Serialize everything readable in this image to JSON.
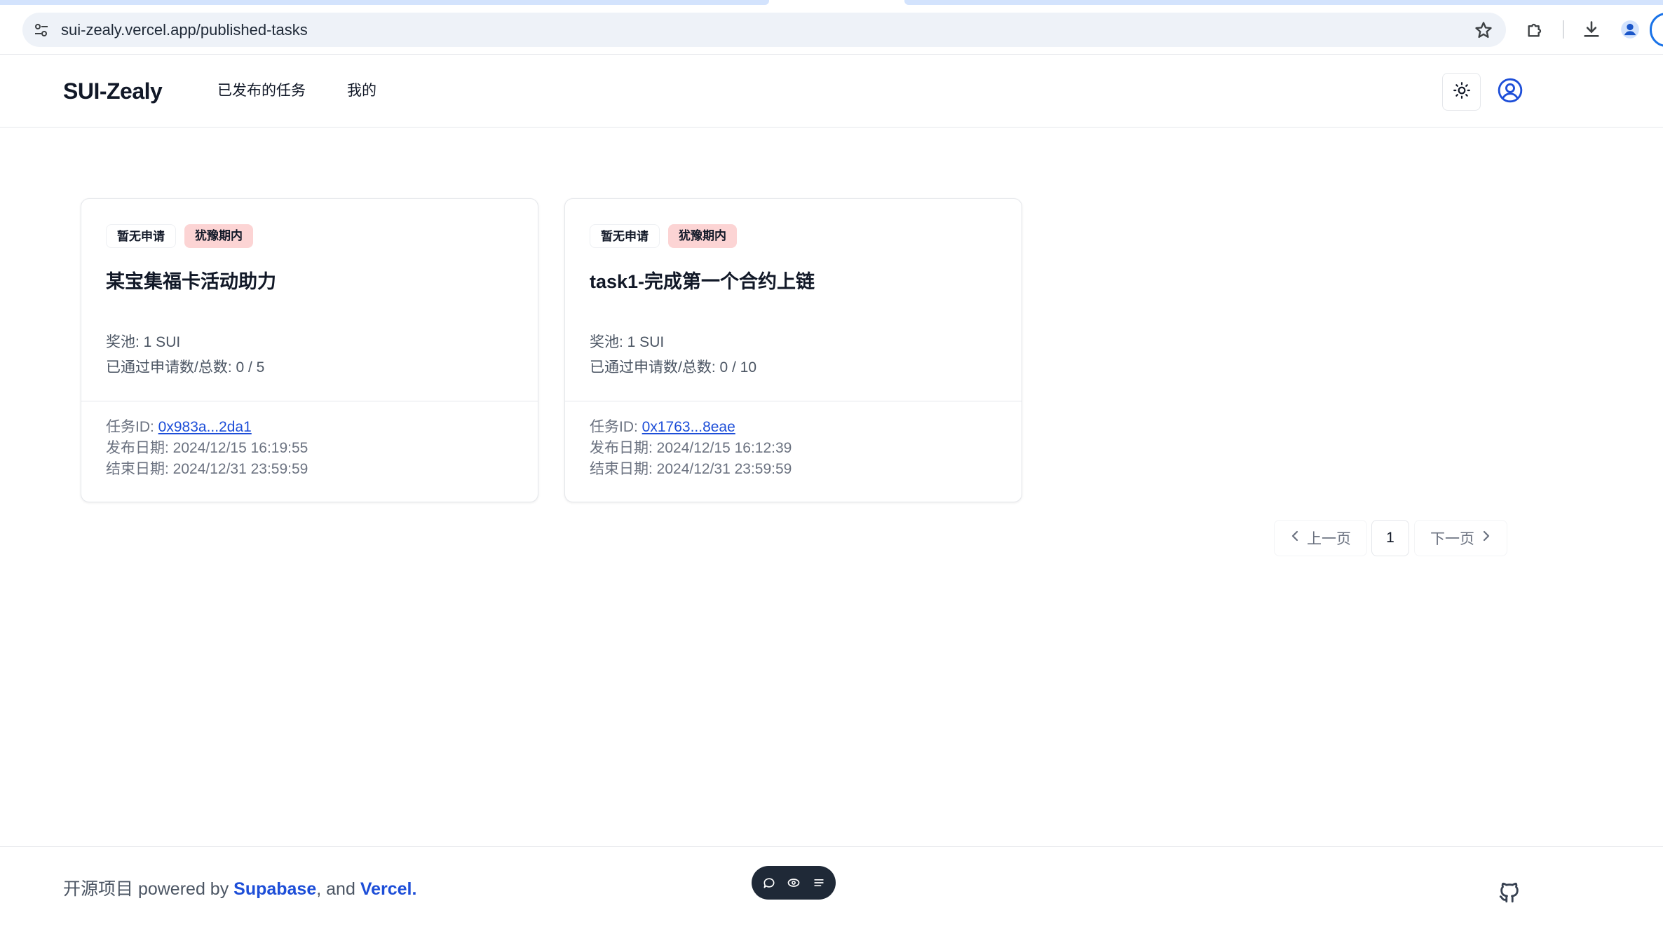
{
  "browser": {
    "url": "sui-zealy.vercel.app/published-tasks"
  },
  "header": {
    "brand": "SUI-Zealy",
    "nav": [
      {
        "label": "已发布的任务"
      },
      {
        "label": "我的"
      }
    ]
  },
  "tasks": [
    {
      "badges": [
        "暂无申请",
        "犹豫期内"
      ],
      "title": "某宝集福卡活动助力",
      "reward": "奖池: 1 SUI",
      "progress": "已通过申请数/总数: 0 / 5",
      "id_label": "任务ID: ",
      "id_value": "0x983a...2da1",
      "publish": "发布日期: 2024/12/15 16:19:55",
      "end": "结束日期: 2024/12/31 23:59:59"
    },
    {
      "badges": [
        "暂无申请",
        "犹豫期内"
      ],
      "title": "task1-完成第一个合约上链",
      "reward": "奖池: 1 SUI",
      "progress": "已通过申请数/总数: 0 / 10",
      "id_label": "任务ID: ",
      "id_value": "0x1763...8eae",
      "publish": "发布日期: 2024/12/15 16:12:39",
      "end": "结束日期: 2024/12/31 23:59:59"
    }
  ],
  "pagination": {
    "prev": "上一页",
    "current": "1",
    "next": "下一页"
  },
  "footer": {
    "prefix": "开源项目 powered by ",
    "link1": "Supabase",
    "sep": ", and ",
    "link2": "Vercel",
    "suffix": "."
  },
  "colors": {
    "accent_link": "#1d4ed8",
    "badge_red": "#fcd4d4",
    "chrome_blue": "#1a73e8"
  },
  "icons": {
    "omnibox_left": "tune-icon",
    "omnibox_right": "star-icon",
    "toolbar": [
      "extensions-icon",
      "download-icon",
      "profile-icon"
    ],
    "theme": "sun-icon",
    "user": "user-circle-icon",
    "footer": "github-icon"
  }
}
